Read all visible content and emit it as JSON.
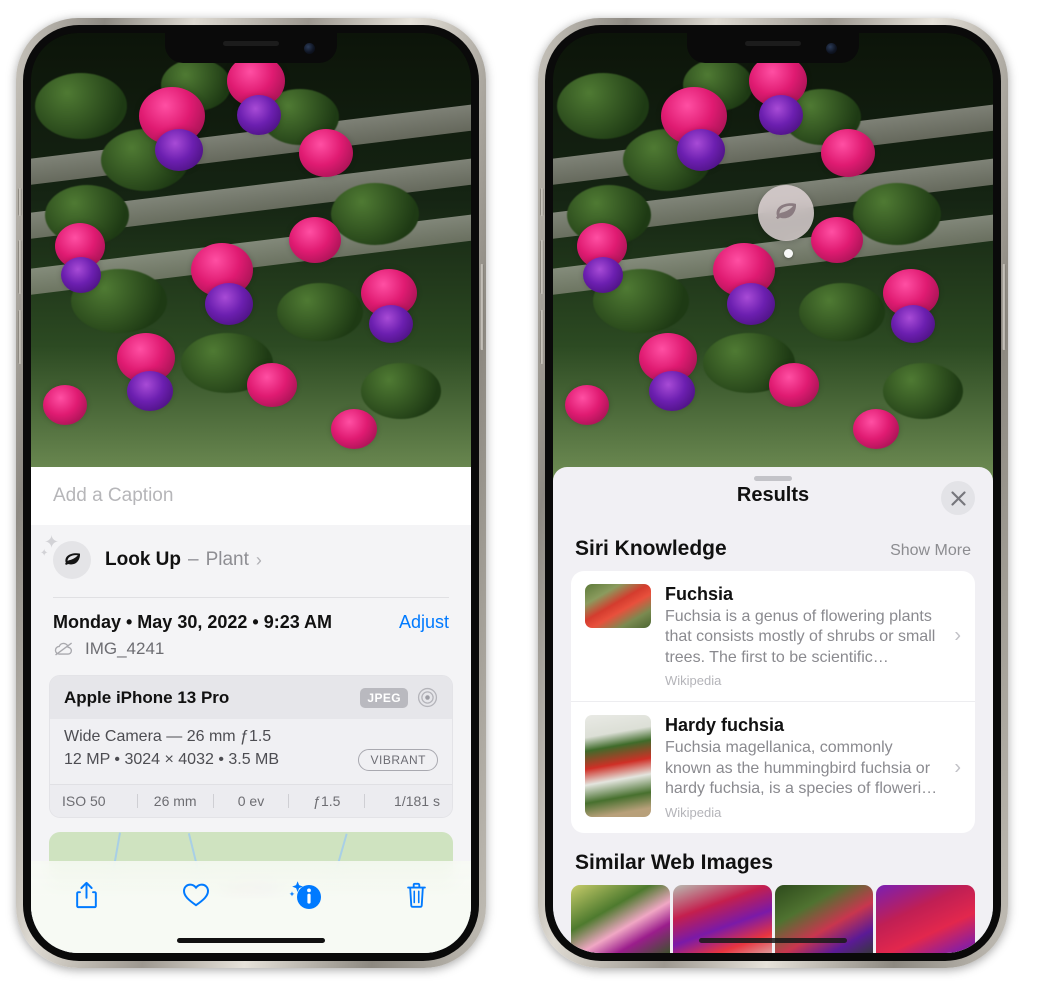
{
  "left_phone": {
    "caption_field": {
      "placeholder": "Add a Caption",
      "value": ""
    },
    "lookup_row": {
      "icon": "leaf-icon",
      "sparkle_icon": "sparkles-icon",
      "label": "Look Up",
      "dash": "–",
      "subject": "Plant",
      "chevron": "›"
    },
    "date_row": {
      "date": "Monday • May 30, 2022 • 9:23 AM",
      "adjust_label": "Adjust"
    },
    "file_row": {
      "icon": "cloud-slash-icon",
      "filename": "IMG_4241"
    },
    "metadata_card": {
      "device": "Apple iPhone 13 Pro",
      "format_badge": "JPEG",
      "format_icon": "raw-target-icon",
      "lens_line": "Wide Camera — 26 mm ƒ1.5",
      "size_line": "12 MP • 3024 × 4032 • 3.5 MB",
      "style_badge": "VIBRANT",
      "exif": [
        "ISO 50",
        "26 mm",
        "0 ev",
        "ƒ1.5",
        "1/181 s"
      ]
    },
    "map_card": {
      "name": "photo-location-map",
      "pin": "photo-pin"
    },
    "toolbar": [
      {
        "name": "share-icon",
        "label": "Share",
        "active": false
      },
      {
        "name": "heart-icon",
        "label": "Favorite",
        "active": false
      },
      {
        "name": "info-sparkle-icon",
        "label": "Info",
        "active": true
      },
      {
        "name": "trash-icon",
        "label": "Delete",
        "active": false
      }
    ]
  },
  "right_phone": {
    "visual_lookup_badge": {
      "icon": "leaf-icon",
      "label": "Visual Look Up"
    },
    "sheet": {
      "grabber": "sheet-grabber",
      "title": "Results",
      "close_icon": "close-icon"
    },
    "siri_knowledge": {
      "title": "Siri Knowledge",
      "show_more": "Show More",
      "items": [
        {
          "title": "Fuchsia",
          "description": "Fuchsia is a genus of flowering plants that consists mostly of shrubs or small trees. The first to be scientific…",
          "source": "Wikipedia",
          "chevron": "›"
        },
        {
          "title": "Hardy fuchsia",
          "description": "Fuchsia magellanica, commonly known as the hummingbird fuchsia or hardy fuchsia, is a species of floweri…",
          "source": "Wikipedia",
          "chevron": "›"
        }
      ]
    },
    "similar_web_images": {
      "title": "Similar Web Images",
      "thumbnails": [
        "fuchsia-thumb-1",
        "fuchsia-thumb-2",
        "fuchsia-thumb-3",
        "fuchsia-thumb-4"
      ]
    }
  },
  "colors": {
    "accent_blue": "#007aff",
    "panel_bg": "#f4f4f6",
    "sheet_bg": "#f1f0f4",
    "text_primary": "#111111",
    "text_secondary": "#8a8a8f"
  }
}
